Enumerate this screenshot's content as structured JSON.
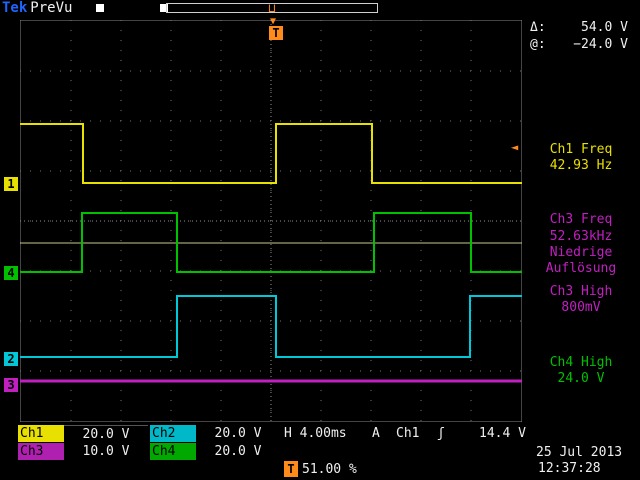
{
  "header": {
    "brand": "Tek",
    "mode": "PreVu"
  },
  "colors": {
    "ch1": "#e8e000",
    "ch2": "#00c8d8",
    "ch3": "#c020c0",
    "ch4": "#00c000",
    "trigger": "#ff8c1a"
  },
  "markers": {
    "ch1": "1",
    "ch2": "2",
    "ch3": "3",
    "ch4": "4",
    "trigger": "T"
  },
  "cursors": {
    "delta_label": "Δ:",
    "delta_value": "54.0 V",
    "at_label": "@:",
    "at_value": "−24.0 V"
  },
  "measurements": {
    "ch1_freq_label": "Ch1 Freq",
    "ch1_freq_value": "42.93 Hz",
    "ch3_freq_label": "Ch3 Freq",
    "ch3_freq_value": "52.63kHz",
    "ch3_freq_note_1": "Niedrige",
    "ch3_freq_note_2": "Auflösung",
    "ch3_high_label": "Ch3 High",
    "ch3_high_value": "800mV",
    "ch4_high_label": "Ch4 High",
    "ch4_high_value": "24.0 V"
  },
  "channels": {
    "ch1_tag": "Ch1",
    "ch1_scale": "20.0 V",
    "ch2_tag": "Ch2",
    "ch2_scale": "20.0 V",
    "ch3_tag": "Ch3",
    "ch3_scale": "10.0 V",
    "ch4_tag": "Ch4",
    "ch4_scale": "20.0 V"
  },
  "timebase": {
    "horizontal": "H 4.00ms",
    "trigger_mode": "A",
    "trigger_source": "Ch1",
    "trigger_slope": "ʃ",
    "trigger_level": "14.4 V",
    "trigger_position": "51.00 %"
  },
  "datetime": {
    "date": "25 Jul  2013",
    "time": "12:37:28"
  }
}
